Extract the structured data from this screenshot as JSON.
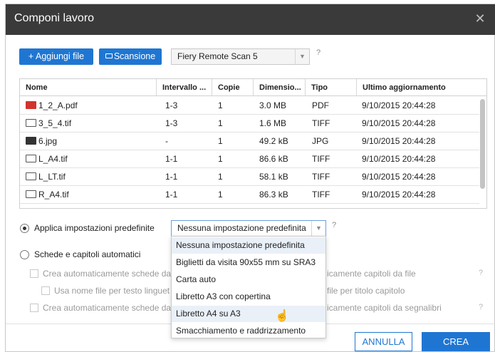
{
  "dialog": {
    "title": "Componi lavoro",
    "close_glyph": "✕"
  },
  "toolbar": {
    "add_label": "+ Aggiungi file",
    "scan_label": "Scansione",
    "scan_source": "Fiery Remote Scan 5",
    "help": "?"
  },
  "table": {
    "columns": [
      "Nome",
      "Intervallo ...",
      "Copie",
      "Dimensio...",
      "Tipo",
      "Ultimo aggiornamento"
    ],
    "rows": [
      {
        "icon": "pdf-file-icon",
        "name": "1_2_A.pdf",
        "range": "1-3",
        "copies": "1",
        "size": "3.0 MB",
        "type": "PDF",
        "updated": "9/10/2015 20:44:28"
      },
      {
        "icon": "tif-file-icon",
        "name": "3_5_4.tif",
        "range": "1-3",
        "copies": "1",
        "size": "1.6 MB",
        "type": "TIFF",
        "updated": "9/10/2015 20:44:28"
      },
      {
        "icon": "jpg-file-icon",
        "name": "6.jpg",
        "range": "-",
        "copies": "1",
        "size": "49.2 kB",
        "type": "JPG",
        "updated": "9/10/2015 20:44:28"
      },
      {
        "icon": "tif-file-icon",
        "name": "L_A4.tif",
        "range": "1-1",
        "copies": "1",
        "size": "86.6 kB",
        "type": "TIFF",
        "updated": "9/10/2015 20:44:28"
      },
      {
        "icon": "tif-file-icon",
        "name": "L_LT.tif",
        "range": "1-1",
        "copies": "1",
        "size": "58.1 kB",
        "type": "TIFF",
        "updated": "9/10/2015 20:44:28"
      },
      {
        "icon": "tif-file-icon",
        "name": "R_A4.tif",
        "range": "1-1",
        "copies": "1",
        "size": "86.3 kB",
        "type": "TIFF",
        "updated": "9/10/2015 20:44:28"
      }
    ]
  },
  "options": {
    "preset_label": "Applica impostazioni predefinite",
    "preset_value": "Nessuna impostazione predefinita",
    "preset_help": "?",
    "auto_label": "Schede e capitoli automatici",
    "auto_tabs_files": "Crea automaticamente schede da",
    "use_filename": "Usa nome file per testo linguet",
    "auto_tabs_bookmarks": "Crea automaticamente schede da",
    "chapters_files": "icamente capitoli da file",
    "filename_chapter": "file per titolo capitolo",
    "chapters_bookmarks": "icamente capitoli da segnalibri",
    "help": "?"
  },
  "dropdown": {
    "items": [
      "Nessuna impostazione predefinita",
      "Biglietti da visita 90x55 mm su SRA3",
      "Carta auto",
      "Libretto A3 con copertina",
      "Libretto A4 su A3",
      "Smacchiamento e raddrizzamento"
    ],
    "selected_index": 0,
    "hover_index": 4
  },
  "footer": {
    "cancel_label": "ANNULLA",
    "create_label": "CREA"
  },
  "colors": {
    "accent": "#1f76d2",
    "titlebar": "#3a3a3a"
  }
}
